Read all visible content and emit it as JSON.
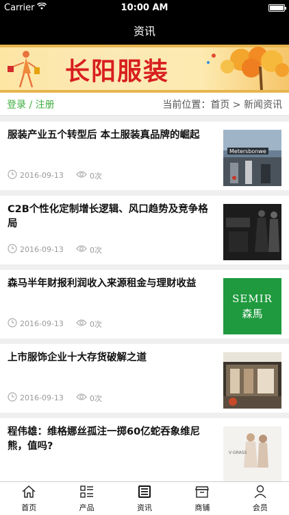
{
  "status": {
    "carrier": "Carrier",
    "time": "10:00 AM"
  },
  "nav": {
    "title": "资讯"
  },
  "banner": {
    "title": "长阳服装"
  },
  "info": {
    "login": "登录 / 注册",
    "location": "当前位置：首页 > 新闻资讯"
  },
  "news": [
    {
      "title": "服装产业五个转型后 本土服装真品牌的崛起",
      "date": "2016-09-13",
      "views": "0次"
    },
    {
      "title": "C2B个性化定制增长逻辑、风口趋势及竞争格局",
      "date": "2016-09-13",
      "views": "0次"
    },
    {
      "title": "森马半年财报利润收入来源租金与理财收益",
      "date": "2016-09-13",
      "views": "0次"
    },
    {
      "title": "上市服饰企业十大存货破解之道",
      "date": "2016-09-13",
      "views": "0次"
    },
    {
      "title": "程伟雄：维格娜丝孤注一掷60亿蛇吞象维尼熊，值吗?",
      "date": "",
      "views": ""
    }
  ],
  "thumbs": {
    "mall_sign": "Metersbonwe",
    "semir_en": "SEMIR",
    "semir_cn": "森馬",
    "vgrass": "V·GRASS"
  },
  "tabs": [
    {
      "label": "首页"
    },
    {
      "label": "产品"
    },
    {
      "label": "资讯"
    },
    {
      "label": "商铺"
    },
    {
      "label": "会员"
    }
  ],
  "colors": {
    "accent_green": "#3fae3f",
    "banner_red": "#d81e1e",
    "semir_green": "#1f9a3e"
  }
}
